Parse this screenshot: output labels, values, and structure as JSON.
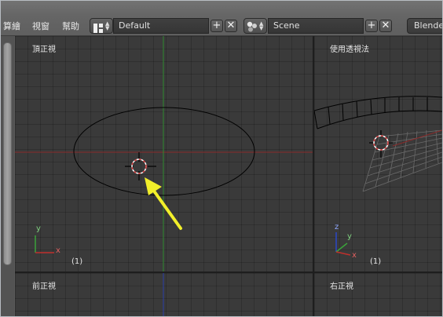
{
  "menu": [
    {
      "id": "render",
      "label": "算繪"
    },
    {
      "id": "window",
      "label": "視窗"
    },
    {
      "id": "help",
      "label": "幫助"
    }
  ],
  "screen_layout": {
    "value": "Default"
  },
  "scene": {
    "value": "Scene"
  },
  "render_engine": {
    "value": "Blende"
  },
  "viewports": {
    "top": {
      "label": "頂正視",
      "frame": "(1)"
    },
    "persp": {
      "label": "使用透視法",
      "frame": "(1)"
    },
    "front": {
      "label": "前正視"
    },
    "right": {
      "label": "右正視"
    }
  },
  "axis_labels": {
    "x": "x",
    "y": "y",
    "z": "z"
  },
  "colors": {
    "axis_x": "#c0302c",
    "axis_y": "#3aa33a",
    "axis_z": "#2a47c8",
    "annotation_arrow": "#f2ef2a",
    "object_outline": "#000000"
  },
  "icons": [
    "layout-grid-icon",
    "scene-spheres-icon",
    "add-icon",
    "close-icon",
    "3d-cursor-icon",
    "arrow-annotation-icon"
  ]
}
